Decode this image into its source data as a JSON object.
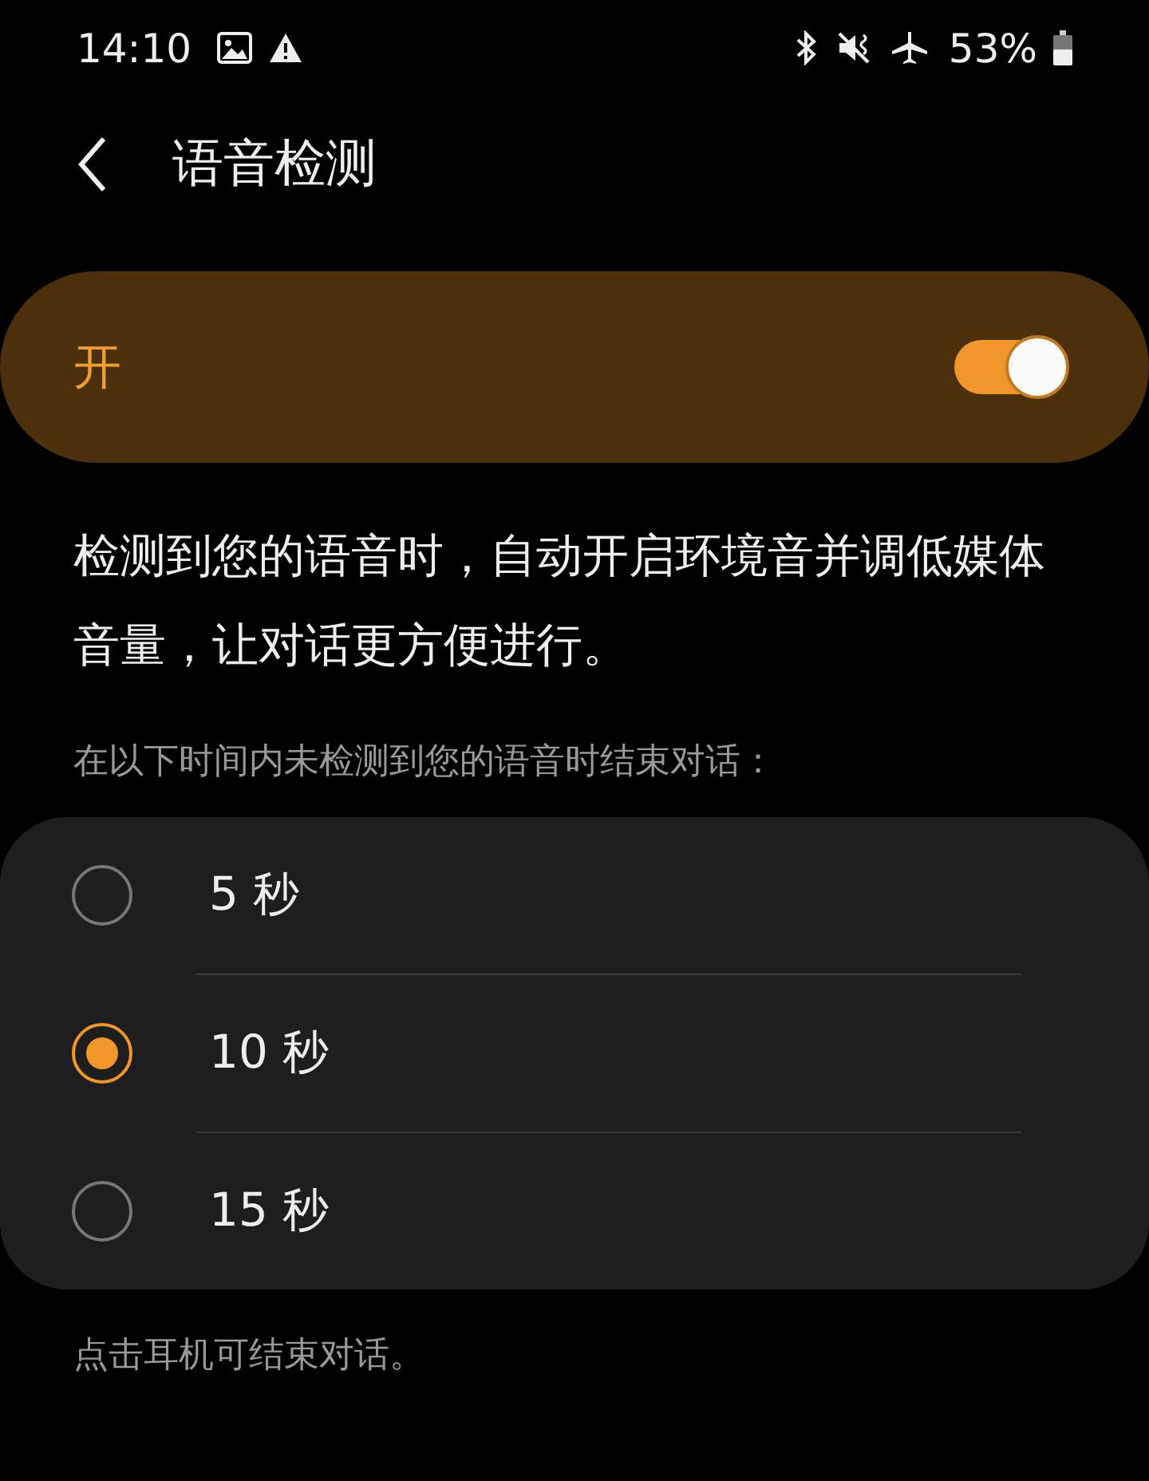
{
  "status_bar": {
    "time": "14:10",
    "battery": "53%"
  },
  "header": {
    "title": "语音检测"
  },
  "master_switch": {
    "label": "开",
    "on": true
  },
  "description": "检测到您的语音时，自动开启环境音并调低媒体音量，让对话更方便进行。",
  "section_label": "在以下时间内未检测到您的语音时结束对话：",
  "options": [
    {
      "label": "5 秒",
      "selected": false
    },
    {
      "label": "10 秒",
      "selected": true
    },
    {
      "label": "15 秒",
      "selected": false
    }
  ],
  "footer": "点击耳机可结束对话。"
}
